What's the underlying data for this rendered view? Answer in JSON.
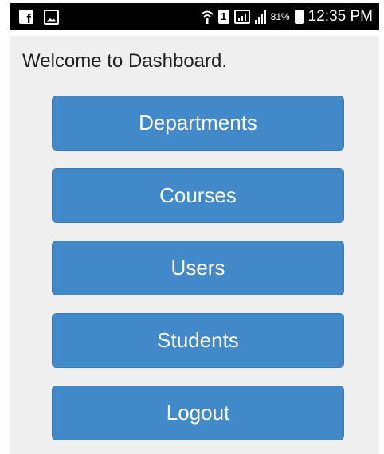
{
  "status_bar": {
    "facebook_glyph": "f",
    "sim_label": "1",
    "battery_percent": "81%",
    "time": "12:35 PM",
    "icons": [
      "facebook-icon",
      "gallery-icon",
      "wifi-icon",
      "sim-icon",
      "signal-icon",
      "cell-signal-icon",
      "battery-icon"
    ]
  },
  "main": {
    "welcome_text": "Welcome to Dashboard.",
    "buttons": [
      {
        "label": "Departments"
      },
      {
        "label": "Courses"
      },
      {
        "label": "Users"
      },
      {
        "label": "Students"
      },
      {
        "label": "Logout"
      }
    ]
  },
  "colors": {
    "button_background": "#4289ca",
    "content_background": "#efefef",
    "status_bar_background": "#000000"
  }
}
